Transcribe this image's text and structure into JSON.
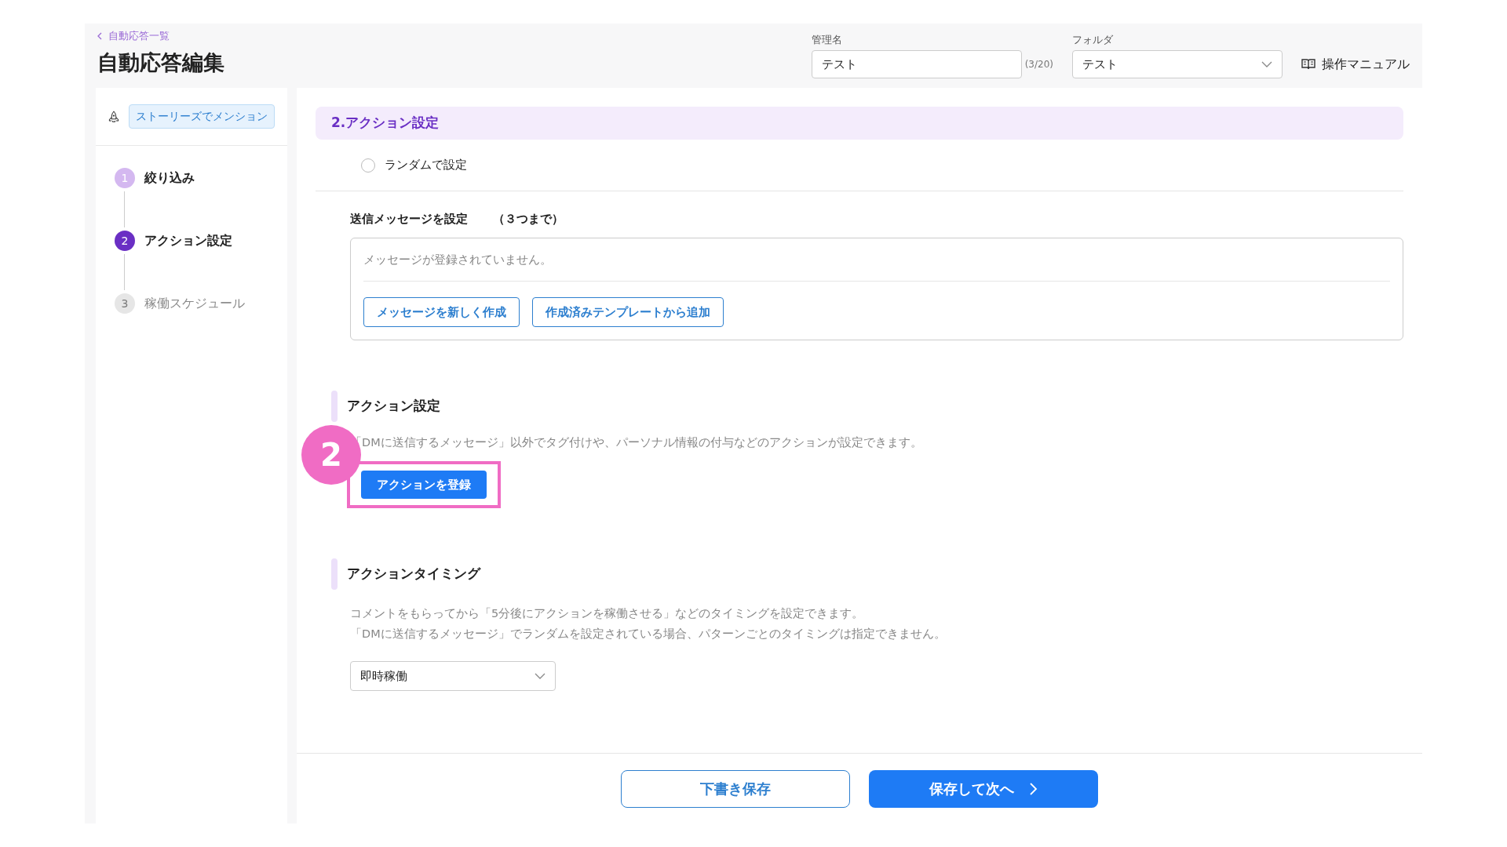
{
  "header": {
    "back_link": "自動応答一覧",
    "title": "自動応答編集",
    "name_field": {
      "label": "管理名",
      "value": "テスト",
      "counter": "(3/20)"
    },
    "folder_field": {
      "label": "フォルダ",
      "value": "テスト"
    },
    "manual_link": "操作マニュアル"
  },
  "sidebar": {
    "trigger_tag": "ストーリーズでメンション",
    "steps": [
      {
        "number": "1",
        "label": "絞り込み",
        "selected": false
      },
      {
        "number": "2",
        "label": "アクション設定",
        "selected": true
      },
      {
        "number": "3",
        "label": "稼働スケジュール",
        "selected": false
      }
    ]
  },
  "main": {
    "section_title": "2.アクション設定",
    "random_option": {
      "label": "ランダムで設定",
      "checked": false
    },
    "messages": {
      "title": "送信メッセージを設定",
      "limit": "（３つまで）",
      "empty_text": "メッセージが登録されていません。",
      "buttons": [
        "メッセージを新しく作成",
        "作成済みテンプレートから追加"
      ]
    },
    "action": {
      "title": "アクション設定",
      "description": "「DMに送信するメッセージ」以外でタグ付けや、パーソナル情報の付与などのアクションが設定できます。",
      "button": "アクションを登録",
      "callout_number": "2"
    },
    "timing": {
      "title": "アクションタイミング",
      "description": [
        "コメントをもらってから「5分後にアクションを稼働させる」などのタイミングを設定できます。",
        "「DMに送信するメッセージ」でランダムを設定されている場合、パターンごとのタイミングは指定できません。"
      ],
      "select_value": "即時稼働"
    }
  },
  "footer": {
    "draft_button": "下書き保存",
    "next_button": "保存して次へ"
  }
}
